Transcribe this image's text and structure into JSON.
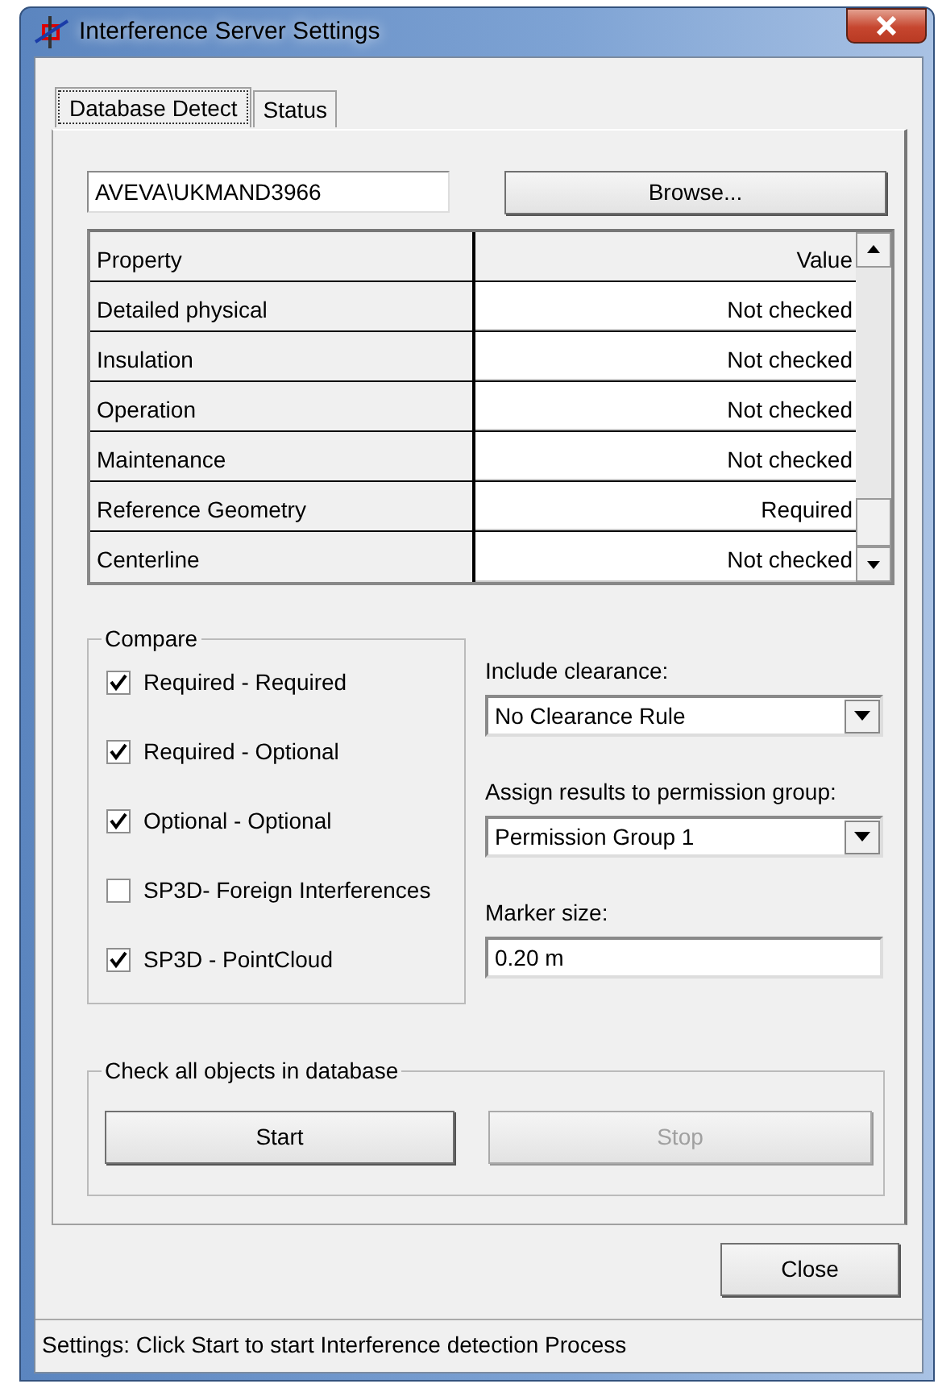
{
  "window": {
    "title": "Interference Server Settings"
  },
  "tabs": [
    {
      "label": "Database Detect",
      "selected": true
    },
    {
      "label": "Status",
      "selected": false
    }
  ],
  "database_field": {
    "value": "AVEVA\\UKMAND3966"
  },
  "browse_button": {
    "label": "Browse..."
  },
  "property_table": {
    "columns": [
      "Property",
      "Value"
    ],
    "rows": [
      {
        "property": "Detailed physical",
        "value": "Not checked"
      },
      {
        "property": "Insulation",
        "value": "Not checked"
      },
      {
        "property": "Operation",
        "value": "Not checked"
      },
      {
        "property": "Maintenance",
        "value": "Not checked"
      },
      {
        "property": "Reference Geometry",
        "value": "Required"
      },
      {
        "property": "Centerline",
        "value": "Not checked"
      }
    ]
  },
  "compare": {
    "title": "Compare",
    "options": [
      {
        "label": "Required - Required",
        "checked": true
      },
      {
        "label": "Required - Optional",
        "checked": true
      },
      {
        "label": "Optional - Optional",
        "checked": true
      },
      {
        "label": "SP3D- Foreign Interferences",
        "checked": false
      },
      {
        "label": "SP3D - PointCloud",
        "checked": true
      }
    ]
  },
  "include_clearance": {
    "label": "Include clearance:",
    "value": "No Clearance Rule"
  },
  "permission_group": {
    "label": "Assign results to permission group:",
    "value": "Permission Group 1"
  },
  "marker_size": {
    "label": "Marker size:",
    "value": "0.20 m"
  },
  "check_all": {
    "title": "Check all objects in database",
    "buttons": [
      {
        "label": "Start",
        "disabled": false
      },
      {
        "label": "Stop",
        "disabled": true
      }
    ]
  },
  "close_button": {
    "label": "Close"
  },
  "status_bar": "Settings: Click Start to start Interference detection Process"
}
